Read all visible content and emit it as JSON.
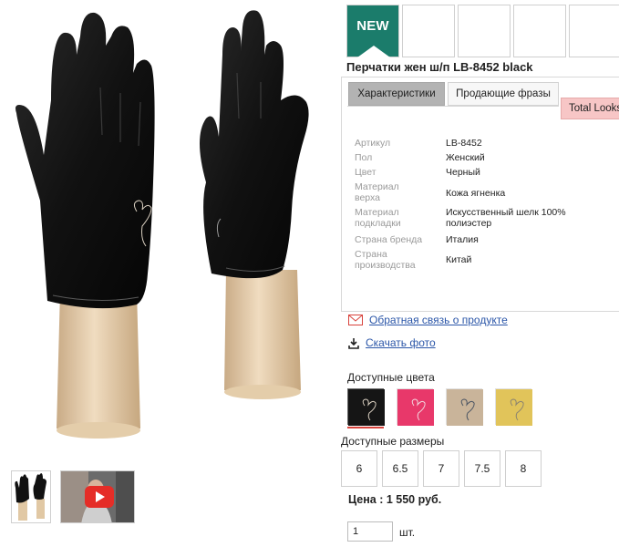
{
  "product": {
    "badge": "NEW",
    "title": "Перчатки жен ш/п LB-8452 black"
  },
  "tabs": [
    {
      "label": "Характеристики",
      "active": true
    },
    {
      "label": "Продающие фразы",
      "active": false
    },
    {
      "label": "Total Looks",
      "active": false
    }
  ],
  "specs": [
    {
      "label": "Артикул",
      "value": "LB-8452"
    },
    {
      "label": "Пол",
      "value": "Женский"
    },
    {
      "label": "Цвет",
      "value": "Черный"
    },
    {
      "label": "Материал верха",
      "value": "Кожа ягненка"
    },
    {
      "label": "Материал подкладки",
      "value": "Искусственный шелк 100% полиэстер"
    },
    {
      "label": "Страна бренда",
      "value": "Италия"
    },
    {
      "label": "Страна производства",
      "value": "Китай"
    }
  ],
  "links": {
    "feedback": "Обратная связь о продукте",
    "download_photo": "Скачать фото"
  },
  "colors": {
    "label": "Доступные цвета",
    "swatches": [
      {
        "name": "black",
        "hex": "#151515",
        "selected": true
      },
      {
        "name": "pink",
        "hex": "#e8386a",
        "selected": false
      },
      {
        "name": "beige",
        "hex": "#c9b49a",
        "selected": false
      },
      {
        "name": "yellow",
        "hex": "#e1c45a",
        "selected": false
      }
    ]
  },
  "sizes": {
    "label": "Доступные размеры",
    "options": [
      "6",
      "6.5",
      "7",
      "7.5",
      "8"
    ]
  },
  "price": "Цена : 1 550 руб.",
  "quantity": {
    "value": "1",
    "unit": "шт."
  },
  "icons": {
    "feedback": "envelope-icon",
    "download": "download-icon",
    "video": "play-icon"
  },
  "palette": {
    "badge_green": "#1b7c6b",
    "link_blue": "#2b56a8",
    "tab_active": "#b3b3b3",
    "tab_pink": "#f7c6c6",
    "selected_underline": "#d8433c"
  }
}
